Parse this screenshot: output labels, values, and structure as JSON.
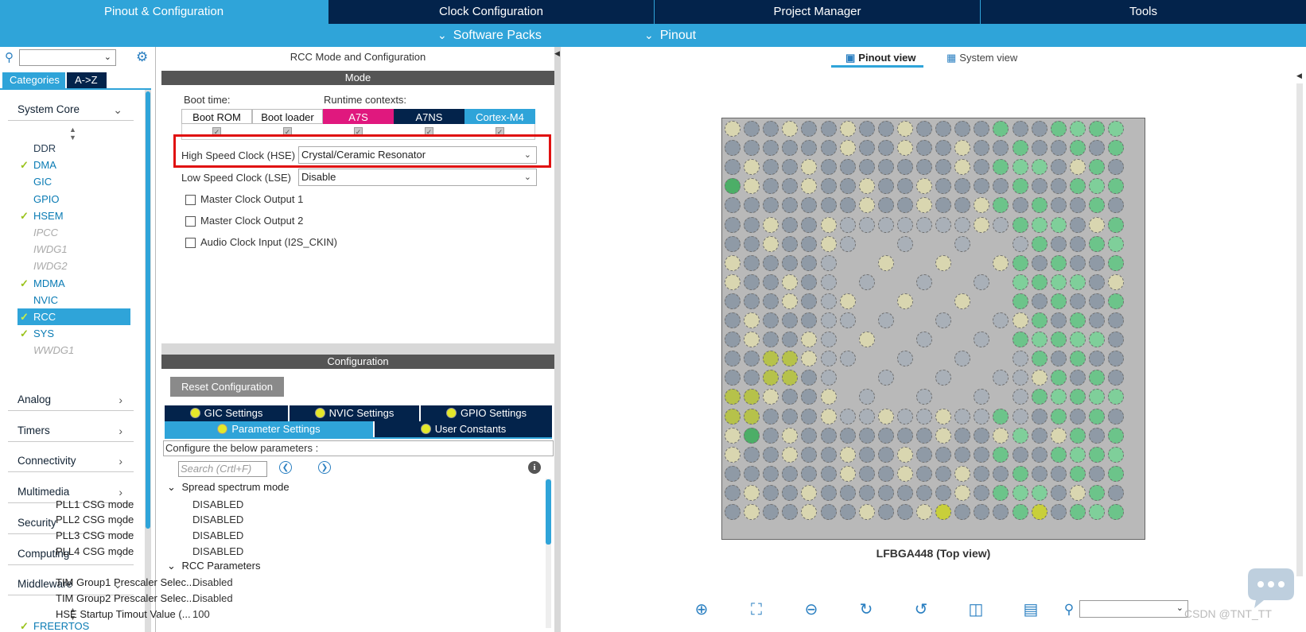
{
  "top_tabs": [
    {
      "label": "Pinout & Configuration"
    },
    {
      "label": "Clock Configuration"
    },
    {
      "label": "Project Manager"
    },
    {
      "label": "Tools"
    }
  ],
  "submenu": {
    "software_packs": "Software Packs",
    "pinout": "Pinout"
  },
  "left": {
    "tab_categories": "Categories",
    "tab_az": "A->Z",
    "system_core": "System Core",
    "peripherals": [
      {
        "label": "DDR",
        "state": "plain",
        "checked": false
      },
      {
        "label": "DMA",
        "state": "norm",
        "checked": true
      },
      {
        "label": "GIC",
        "state": "norm",
        "checked": false
      },
      {
        "label": "GPIO",
        "state": "norm",
        "checked": false
      },
      {
        "label": "HSEM",
        "state": "norm",
        "checked": true
      },
      {
        "label": "IPCC",
        "state": "dis",
        "checked": false
      },
      {
        "label": "IWDG1",
        "state": "dis",
        "checked": false
      },
      {
        "label": "IWDG2",
        "state": "dis",
        "checked": false
      },
      {
        "label": "MDMA",
        "state": "norm",
        "checked": true
      },
      {
        "label": "NVIC",
        "state": "norm",
        "checked": false
      },
      {
        "label": "RCC",
        "state": "sel",
        "checked": true
      },
      {
        "label": "SYS",
        "state": "norm",
        "checked": true
      },
      {
        "label": "WWDG1",
        "state": "dis",
        "checked": false
      }
    ],
    "categories": [
      "Analog",
      "Timers",
      "Connectivity",
      "Multimedia",
      "Security",
      "Computing",
      "Middleware"
    ],
    "freertos": "FREERTOS"
  },
  "mode": {
    "title": "RCC Mode and Configuration",
    "bar": "Mode",
    "boot_time": "Boot time:",
    "runtime_contexts": "Runtime contexts:",
    "contexts": [
      "Boot ROM",
      "Boot loader",
      "A7S",
      "A7NS",
      "Cortex-M4"
    ],
    "hse_label": "High Speed Clock (HSE)",
    "hse_value": "Crystal/Ceramic Resonator",
    "lse_label": "Low Speed Clock (LSE)",
    "lse_value": "Disable",
    "checkboxes": [
      "Master Clock Output 1",
      "Master Clock Output 2",
      "Audio Clock Input (I2S_CKIN)"
    ]
  },
  "config": {
    "bar": "Configuration",
    "reset": "Reset Configuration",
    "tabs_row1": [
      "GIC Settings",
      "NVIC Settings",
      "GPIO Settings"
    ],
    "tabs_row2": [
      "Parameter Settings",
      "User Constants"
    ],
    "hint": "Configure the below parameters :",
    "search_placeholder": "Search (Crtl+F)",
    "groups": [
      {
        "name": "Spread spectrum mode",
        "rows": [
          {
            "name": "PLL1 CSG mode",
            "value": "DISABLED"
          },
          {
            "name": "PLL2 CSG mode",
            "value": "DISABLED"
          },
          {
            "name": "PLL3 CSG mode",
            "value": "DISABLED"
          },
          {
            "name": "PLL4 CSG mode",
            "value": "DISABLED"
          }
        ]
      },
      {
        "name": "RCC Parameters",
        "rows": [
          {
            "name": "TIM Group1 Prescaler Selec...",
            "value": "Disabled"
          },
          {
            "name": "TIM Group2 Prescaler Selec...",
            "value": "Disabled"
          },
          {
            "name": "HSE Startup Timout Value (...",
            "value": "100"
          }
        ]
      }
    ]
  },
  "right": {
    "pinout_view": "Pinout view",
    "system_view": "System view",
    "chip_label": "LFBGA448 (Top view)",
    "watermark": "CSDN @TNT_TT"
  },
  "colors": {
    "accent": "#2fa4d9",
    "navy": "#03234b",
    "a7s": "#e0187e",
    "highlight": "#e01010"
  }
}
